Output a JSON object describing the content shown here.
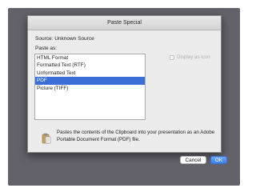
{
  "dialog": {
    "title": "Paste Special",
    "source_text": "Source:  Unknown Source",
    "paste_as_label": "Paste as:",
    "options": [
      {
        "label": "HTML Format",
        "selected": false
      },
      {
        "label": "Formatted Text (RTF)",
        "selected": false
      },
      {
        "label": "Unformatted Text",
        "selected": false
      },
      {
        "label": "PDF",
        "selected": true
      },
      {
        "label": "Picture (TIFF)",
        "selected": false
      }
    ],
    "display_as_icon_label": "Display as icon",
    "display_as_icon_checked": false,
    "result_text": "Pastes the contents of the Clipboard into your presentation as an Adobe Portable Document Format (PDF) file.",
    "result_icon": "clipboard-paste-icon",
    "cancel_label": "Cancel",
    "ok_label": "OK"
  },
  "colors": {
    "selection": "#3a6fd8",
    "ok_button": "#3c80f4",
    "backdrop": "#636169"
  }
}
